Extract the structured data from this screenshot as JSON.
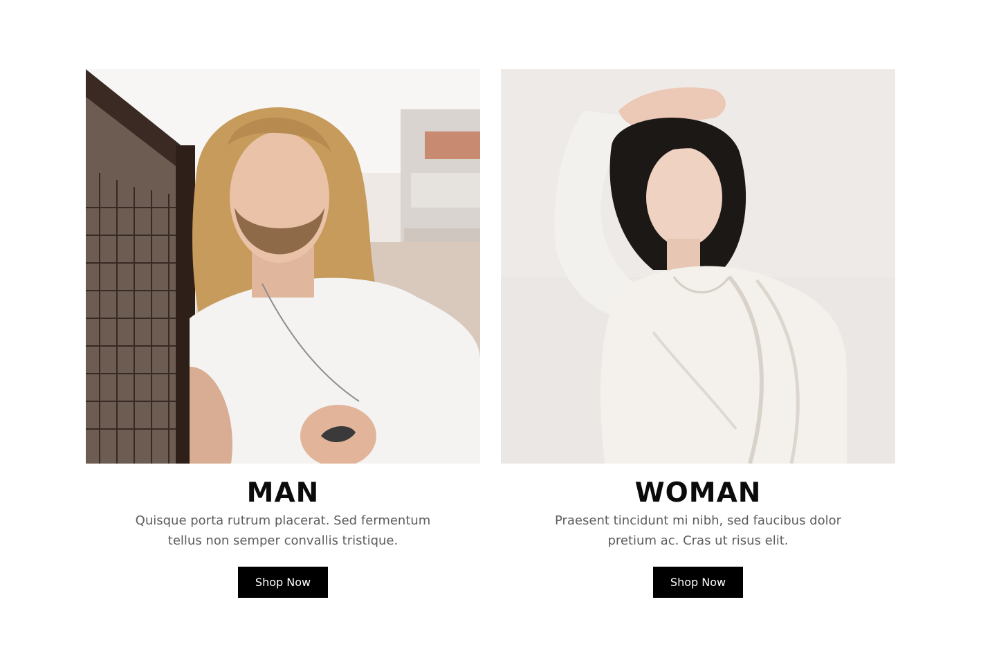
{
  "categories": [
    {
      "title": "MAN",
      "description": "Quisque porta rutrum placerat. Sed fermentum tellus non semper convallis tristique.",
      "button_label": "Shop Now",
      "image_alt": "man-photo"
    },
    {
      "title": "WOMAN",
      "description": "Praesent tincidunt mi nibh, sed faucibus dolor pretium ac. Cras ut risus elit.",
      "button_label": "Shop Now",
      "image_alt": "woman-photo"
    }
  ],
  "colors": {
    "button_bg": "#000000",
    "button_text": "#ffffff",
    "title": "#0b0b0b",
    "description": "#5c5c5c",
    "background": "#ffffff"
  }
}
